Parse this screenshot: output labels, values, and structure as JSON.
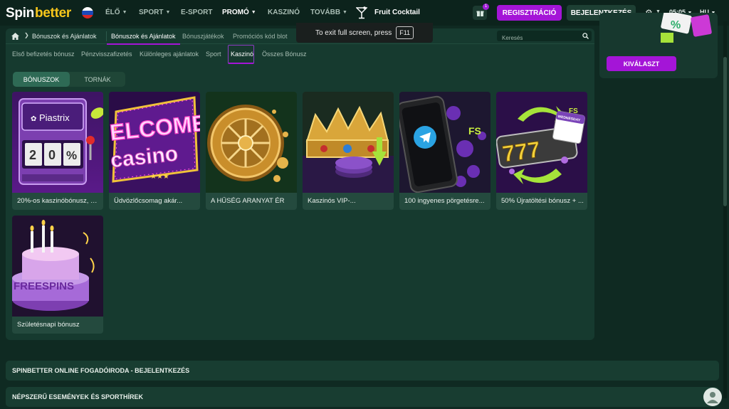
{
  "logo": {
    "spin": "Spin",
    "better": "better"
  },
  "nav": {
    "items": [
      {
        "label": "ÉLŐ",
        "chevron": true
      },
      {
        "label": "SPORT",
        "chevron": true
      },
      {
        "label": "E-SPORT",
        "chevron": false
      },
      {
        "label": "PROMÓ",
        "chevron": true,
        "active": true
      },
      {
        "label": "KASZINÓ",
        "chevron": false
      },
      {
        "label": "TOVÁBB",
        "chevron": true
      }
    ],
    "fruit_label": "Fruit Cocktail",
    "gift_badge": "1",
    "register": "REGISZTRÁCIÓ",
    "login": "BEJELENTKEZÉS",
    "time": "05:05",
    "language": "HU"
  },
  "fullscreen_toast": {
    "text": "To exit full screen, press",
    "key": "F11"
  },
  "breadcrumb": {
    "current": "Bónuszok és Ajánlatok",
    "tabs": [
      "Bónuszok és Ajánlatok",
      "Bónuszjátékok",
      "Promóciós kód blot"
    ],
    "search_placeholder": "Keresés"
  },
  "subtabs": [
    "Első befizetés bónusz",
    "Pénzvisszafizetés",
    "Különleges ajánlatok",
    "Sport",
    "Kaszinó",
    "Összes Bónusz"
  ],
  "segments": [
    "BÓNUSZOK",
    "TORNÁK"
  ],
  "cards": [
    {
      "caption": "20%-os kaszinóbónusz, h...",
      "image_text": "Piastrix",
      "reels": "20%"
    },
    {
      "caption": "Üdvözlőcsomag akár...",
      "image_text": "ELCOME",
      "image_text2": "casino"
    },
    {
      "caption": "A HŰSÉG ARANYAT ÉR"
    },
    {
      "caption": "Kaszinós VIP-..."
    },
    {
      "caption": "100 ingyenes pörgetésre..."
    },
    {
      "caption": "50% Újratöltési bónusz + ...",
      "image_text": "777",
      "image_text2": "WEDNESDAY",
      "image_text3": "FS"
    },
    {
      "caption": "Születésnapi bónusz",
      "image_text": "FREESPINS"
    }
  ],
  "promo_card": {
    "button": "KIVÁLASZT",
    "badge_text": "%"
  },
  "accordions": [
    "SPINBETTER ONLINE FOGADÓIRODA - BEJELENTKEZÉS",
    "NÉPSZERŰ ESEMÉNYEK ÉS SPORTHÍREK"
  ],
  "colors": {
    "accent_purple": "#a415d7",
    "brand_yellow": "#f7c61b",
    "panel": "#163a2f",
    "background": "#0f2a22"
  }
}
